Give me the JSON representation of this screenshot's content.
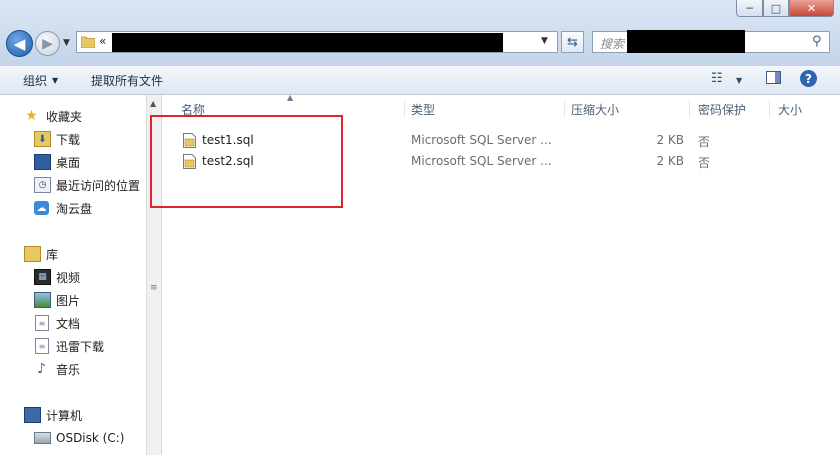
{
  "window": {
    "min_glyph": "─",
    "max_glyph": "□",
    "close_glyph": "✕"
  },
  "address_bar": {
    "chevron": "«"
  },
  "search": {
    "placeholder": "搜索"
  },
  "toolbar": {
    "organize_label": "组织",
    "extract_label": "提取所有文件"
  },
  "nav": {
    "favorites": {
      "label": "收藏夹",
      "items": [
        {
          "label": "下载",
          "icon": "download-folder-icon"
        },
        {
          "label": "桌面",
          "icon": "desktop-icon"
        },
        {
          "label": "最近访问的位置",
          "icon": "recent-places-icon"
        },
        {
          "label": "淘云盘",
          "icon": "cloud-drive-icon"
        }
      ]
    },
    "libraries": {
      "label": "库",
      "items": [
        {
          "label": "视频",
          "icon": "video-icon"
        },
        {
          "label": "图片",
          "icon": "picture-icon"
        },
        {
          "label": "文档",
          "icon": "document-icon"
        },
        {
          "label": "迅雷下载",
          "icon": "thunder-download-icon"
        },
        {
          "label": "音乐",
          "icon": "music-icon"
        }
      ]
    },
    "computer": {
      "label": "计算机",
      "items": [
        {
          "label": "OSDisk (C:)",
          "icon": "disk-icon"
        }
      ]
    }
  },
  "columns": {
    "name": "名称",
    "type": "类型",
    "compressed_size": "压缩大小",
    "password": "密码保护",
    "size": "大小"
  },
  "files": [
    {
      "name": "test1.sql",
      "type": "Microsoft SQL Server ...",
      "compressed_size": "2 KB",
      "password": "否"
    },
    {
      "name": "test2.sql",
      "type": "Microsoft SQL Server ...",
      "compressed_size": "2 KB",
      "password": "否"
    }
  ],
  "colors": {
    "highlight_box": "#e0242b",
    "accent": "#2f66b4"
  }
}
